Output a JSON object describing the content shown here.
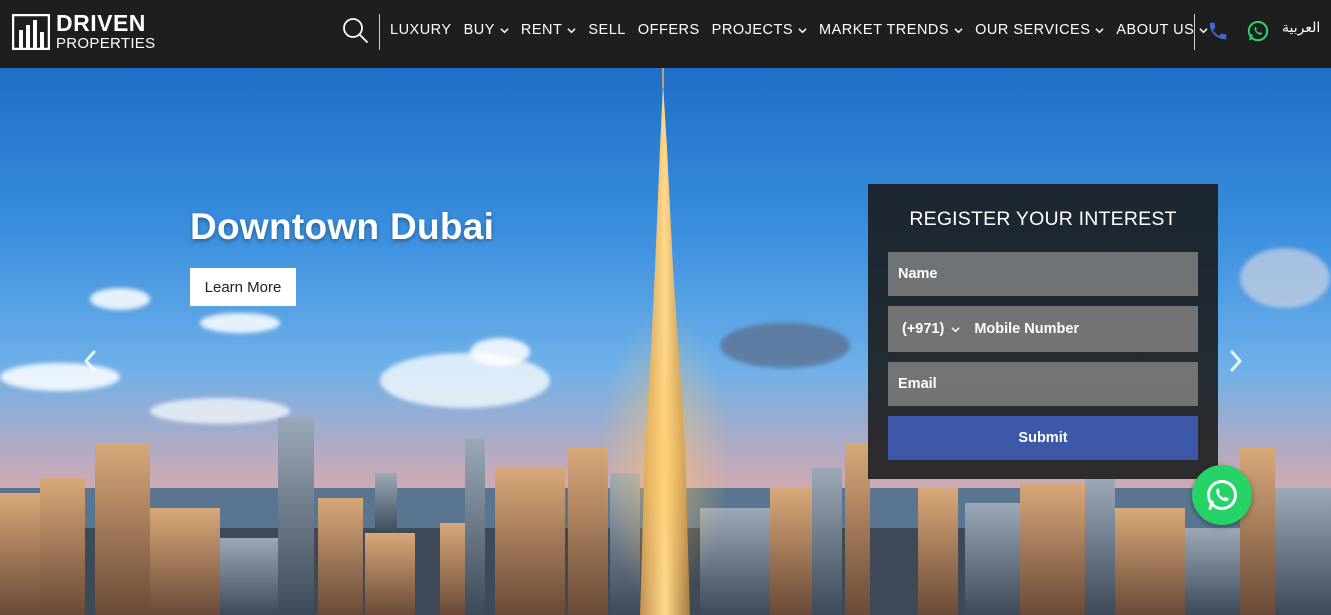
{
  "brand": {
    "title": "DRIVEN",
    "subtitle": "PROPERTIES"
  },
  "header": {
    "nav": [
      {
        "label": "LUXURY",
        "dropdown": false
      },
      {
        "label": "BUY",
        "dropdown": true
      },
      {
        "label": "RENT",
        "dropdown": true
      },
      {
        "label": "SELL",
        "dropdown": false
      },
      {
        "label": "OFFERS",
        "dropdown": false
      },
      {
        "label": "PROJECTS",
        "dropdown": true
      },
      {
        "label": "MARKET TRENDS",
        "dropdown": true
      },
      {
        "label": "OUR SERVICES",
        "dropdown": true
      },
      {
        "label": "ABOUT US",
        "dropdown": true
      }
    ],
    "language_label": "العربية",
    "icons": {
      "search": "search-icon",
      "phone": "phone-icon",
      "whatsapp": "whatsapp-icon"
    }
  },
  "hero": {
    "title": "Downtown Dubai",
    "cta_label": "Learn More"
  },
  "form": {
    "title": "REGISTER YOUR INTEREST",
    "name_placeholder": "Name",
    "country_code": "(+971)",
    "mobile_placeholder": "Mobile Number",
    "email_placeholder": "Email",
    "submit_label": "Submit"
  },
  "colors": {
    "header_bg": "#1e1e1e",
    "submit_bg": "#3d58a8",
    "whatsapp": "#25d366",
    "phone": "#3d6bd1"
  }
}
